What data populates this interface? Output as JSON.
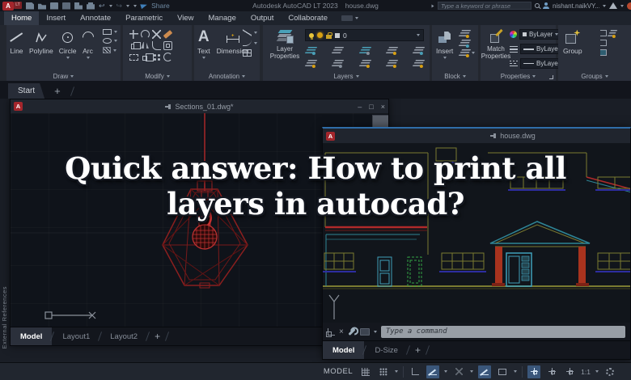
{
  "titlebar": {
    "logo_text": "A",
    "logo_badge": "LT",
    "share_label": "Share",
    "app_title": "Autodesk AutoCAD LT 2023",
    "doc_title": "house.dwg",
    "search_placeholder": "Type a keyword or phrase",
    "user_name": "nishant.naikVY..."
  },
  "ribbon": {
    "tabs": [
      "Home",
      "Insert",
      "Annotate",
      "Parametric",
      "View",
      "Manage",
      "Output",
      "Collaborate"
    ],
    "active_tab": "Home",
    "draw": {
      "label": "Draw",
      "line": "Line",
      "polyline": "Polyline",
      "circle": "Circle",
      "arc": "Arc"
    },
    "modify": {
      "label": "Modify"
    },
    "annotation": {
      "label": "Annotation",
      "big_a": "A",
      "text": "Text",
      "dimension": "Dimension"
    },
    "layers": {
      "label": "Layers",
      "layer_properties_1": "Layer",
      "layer_properties_2": "Properties",
      "current_layer": "0"
    },
    "block": {
      "label": "Block",
      "insert": "Insert"
    },
    "properties": {
      "label": "Properties",
      "match_1": "Match",
      "match_2": "Properties",
      "color_value": "ByLayer",
      "lineweight_value": "ByLayer",
      "linetype_value": "ByLayer"
    },
    "groups": {
      "label": "Groups",
      "group": "Group"
    }
  },
  "file_tabs": {
    "start_tab": "Start",
    "new_tab": "+"
  },
  "left_palette": {
    "label": "External References"
  },
  "sections_window": {
    "title": "Sections_01.dwg*",
    "controls": {
      "minimize": "–",
      "maximize": "□",
      "close": "×"
    },
    "tabs": [
      "Model",
      "Layout1",
      "Layout2"
    ],
    "new_layout": "+"
  },
  "house_window": {
    "title": "house.dwg",
    "tabs": [
      "Model",
      "D-Size"
    ],
    "new_layout": "+",
    "command_placeholder": "Type a command"
  },
  "overlay": {
    "line1": "Quick answer: How to print all",
    "line2": "layers in autocad?"
  },
  "statusbar": {
    "model_label": "MODEL",
    "scale_label": "1:1"
  },
  "colors": {
    "accent_blue": "#3a567a",
    "window_top_border": "#2f6da8",
    "canvas": "#0f131a",
    "lamp_red": "#8c1f1f",
    "house_olive": "#7a7a30",
    "house_cyan": "#3fa0ba",
    "house_sill_blue": "#2d2da0",
    "house_green": "#33a544",
    "house_column_red": "#a8331e",
    "logo_red": "#a4262c"
  }
}
